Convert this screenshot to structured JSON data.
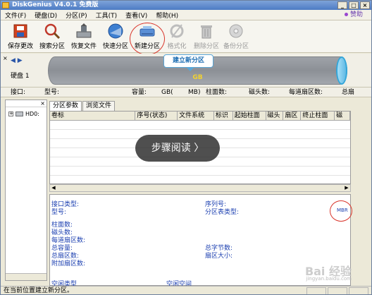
{
  "window": {
    "title": "DiskGenius V4.0.1 免费版",
    "controls": [
      "_",
      "□",
      "×"
    ]
  },
  "menu": {
    "items": [
      "文件(F)",
      "硬盘(D)",
      "分区(P)",
      "工具(T)",
      "查看(V)",
      "帮助(H)"
    ],
    "donate": "赞助"
  },
  "toolbar": {
    "tools": [
      {
        "label": "保存更改",
        "icon": "save-disk-icon",
        "enabled": true
      },
      {
        "label": "搜索分区",
        "icon": "magnifier-icon",
        "enabled": true
      },
      {
        "label": "恢复文件",
        "icon": "recover-icon",
        "enabled": true
      },
      {
        "label": "快速分区",
        "icon": "quick-partition-icon",
        "enabled": true
      },
      {
        "label": "新建分区",
        "icon": "new-partition-icon",
        "enabled": true
      },
      {
        "label": "格式化",
        "icon": "format-icon",
        "enabled": false
      },
      {
        "label": "删除分区",
        "icon": "trash-icon",
        "enabled": false
      },
      {
        "label": "备份分区",
        "icon": "backup-icon",
        "enabled": false
      }
    ]
  },
  "disk_bar": {
    "disk_label": "硬盘 1",
    "capacity_text": "GB",
    "tooltip": "建立新分区"
  },
  "info_line": {
    "interface": "接口:",
    "model": "型号:",
    "capacity": "容量:",
    "gb": "GB(",
    "mb": "MB)",
    "cylinders": "柱面数:",
    "heads": "磁头数:",
    "sectors": "每道扇区数:",
    "total": "总扇"
  },
  "tree": {
    "item": "HD0:"
  },
  "tabs": [
    "分区参数",
    "浏览文件"
  ],
  "table": {
    "columns": [
      "卷标",
      "序号(状态)",
      "文件系统",
      "标识",
      "起始柱面",
      "磁头",
      "扇区",
      "终止柱面",
      "磁"
    ]
  },
  "overlay": {
    "label": "步骤阅读 〉"
  },
  "details": {
    "left": [
      "接口类型:",
      "型号:",
      "柱面数:",
      "磁头数:",
      "每道扇区数:",
      "总容量:",
      "总扇区数:",
      "附加扇区数:"
    ],
    "right": [
      "序列号:",
      "分区表类型:",
      "总字节数:",
      "扇区大小:"
    ],
    "mbr": "MBR",
    "bottom_left": "空闲类型",
    "bottom_right": "空闲空间"
  },
  "status": {
    "text": "在当前位置建立新分区。"
  },
  "watermark": {
    "brand": "Bai 经验",
    "url": "jingyan.baidu.com"
  },
  "colors": {
    "title_bar": "#4d7bc4",
    "highlight_ring": "#d9352b",
    "tooltip_text": "#1f6fb3",
    "gb_text": "#f2d22f",
    "detail_text": "#1b3fb0"
  }
}
